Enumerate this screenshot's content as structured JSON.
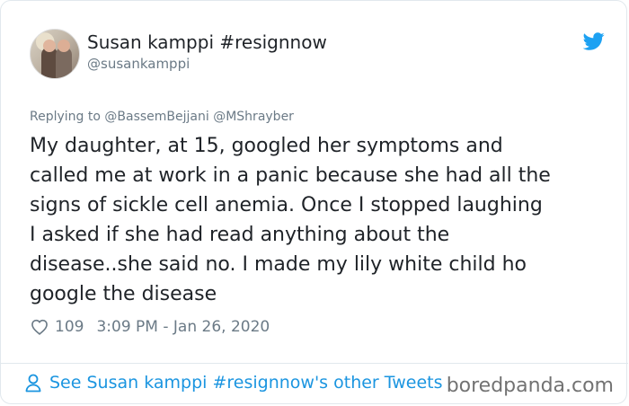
{
  "tweet": {
    "author_name": "Susan kamppi #resignnow",
    "author_handle": "@susankamppi",
    "replying_prefix": "Replying to",
    "replying_mentions": [
      "@BassemBejjani",
      "@MShrayber"
    ],
    "text_lines": [
      "My daughter, at 15, googled her symptoms and",
      "called me at work in a panic because she had all the",
      "signs of sickle cell anemia.  Once I stopped laughing",
      "I asked if she had read anything about the",
      "disease..she said no.  I made my lily white child ho",
      "google the disease"
    ],
    "likes": "109",
    "timestamp": "3:09 PM - Jan 26, 2020",
    "see_more": "See Susan kamppi #resignnow's other Tweets"
  },
  "watermark": "boredpanda.com",
  "icons": {
    "platform": "twitter-bird-icon",
    "like": "heart-icon",
    "profile": "person-icon"
  },
  "colors": {
    "twitter_blue": "#1da1f2",
    "link_blue": "#1b95e0",
    "secondary_text": "#6b7a86",
    "border": "#e1e8ed"
  }
}
